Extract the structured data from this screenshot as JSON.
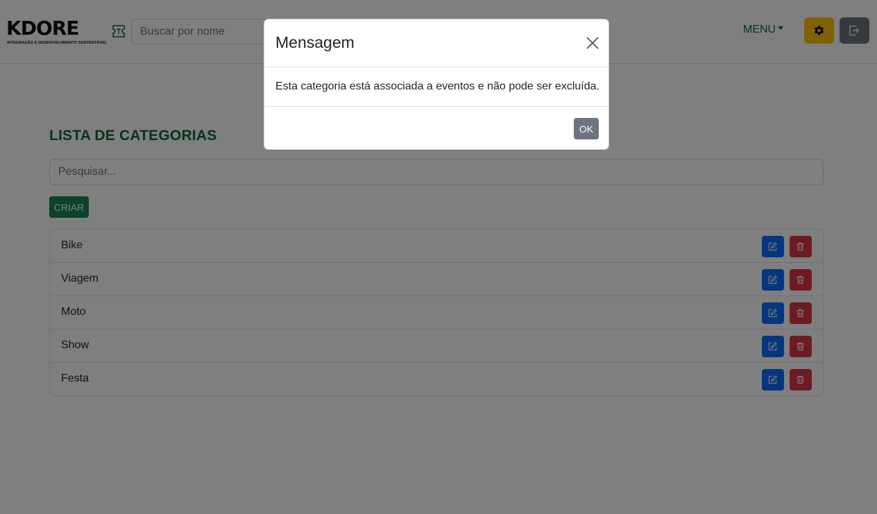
{
  "navbar": {
    "logo_text": "KDORE",
    "logo_subtitle": "INTEGRAÇÃO E DESENVOLVIMENTO SUSTENTÁVEL",
    "search_placeholder": "Buscar por nome",
    "menu_label": "MENU"
  },
  "main": {
    "title": "LISTA DE CATEGORIAS",
    "search_placeholder": "Pesquisar...",
    "create_label": "CRIAR",
    "categories": [
      "Bike",
      "Viagem",
      "Moto",
      "Show",
      "Festa"
    ]
  },
  "modal": {
    "title": "Mensagem",
    "message": "Esta categoria está associada a eventos e não pode ser excluída.",
    "ok_label": "OK"
  },
  "colors": {
    "brand_green": "#0a6b3a",
    "create_button": "#198754",
    "edit_button": "#0d6efd",
    "delete_button": "#dc3545",
    "settings_button": "#ffc107",
    "logout_button": "#6c757d"
  },
  "icons": {
    "ticket": "ticket-icon",
    "settings": "gear-icon",
    "logout": "logout-icon",
    "edit": "pencil-square-icon",
    "delete": "trash-icon",
    "close": "close-icon"
  }
}
